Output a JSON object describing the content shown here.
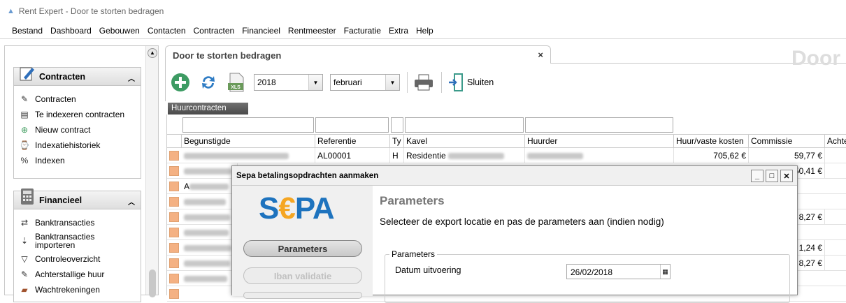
{
  "window": {
    "title": "Rent Expert - Door te storten bedragen"
  },
  "menu": [
    "Bestand",
    "Dashboard",
    "Gebouwen",
    "Contacten",
    "Contracten",
    "Financieel",
    "Rentmeester",
    "Facturatie",
    "Extra",
    "Help"
  ],
  "sidebar": {
    "contracten": {
      "title": "Contracten",
      "items": [
        "Contracten",
        "Te indexeren contracten",
        "Nieuw contract",
        "Indexatiehistoriek",
        "Indexen"
      ]
    },
    "financieel": {
      "title": "Financieel",
      "items": [
        "Banktransacties",
        "Banktransacties importeren",
        "Controleoverzicht",
        "Achterstallige huur",
        "Wachtrekeningen"
      ]
    }
  },
  "tab": {
    "title": "Door te storten bedragen",
    "close": "×",
    "big_title": "Door"
  },
  "toolbar": {
    "year": "2018",
    "month": "februari",
    "close_label": "Sluiten",
    "xls": "XLS"
  },
  "grid": {
    "label": "Huurcontracten",
    "columns": [
      "Begunstigde",
      "Referentie",
      "Ty",
      "Kavel",
      "Huurder",
      "Huur/vaste kosten",
      "Commissie",
      "Achte"
    ],
    "row1": {
      "ref": "AL00001",
      "type": "H",
      "kavel": "Residentie",
      "huur": "705,62 €",
      "comm": "59,77 €"
    },
    "peek": [
      "50,41 €",
      "8,27 €",
      "1,24 €",
      "8,27 €"
    ],
    "row3_prefix": "A"
  },
  "dialog": {
    "title": "Sepa betalingsopdrachten aanmaken",
    "logo_s": "S",
    "logo_e": "€",
    "logo_pa": "PA",
    "step1": "Parameters",
    "step2": "Iban validatie",
    "heading": "Parameters",
    "desc": "Selecteer de export locatie en pas de parameters aan (indien nodig)",
    "group": "Parameters",
    "date_label": "Datum uitvoering",
    "date_value": "26/02/2018"
  }
}
